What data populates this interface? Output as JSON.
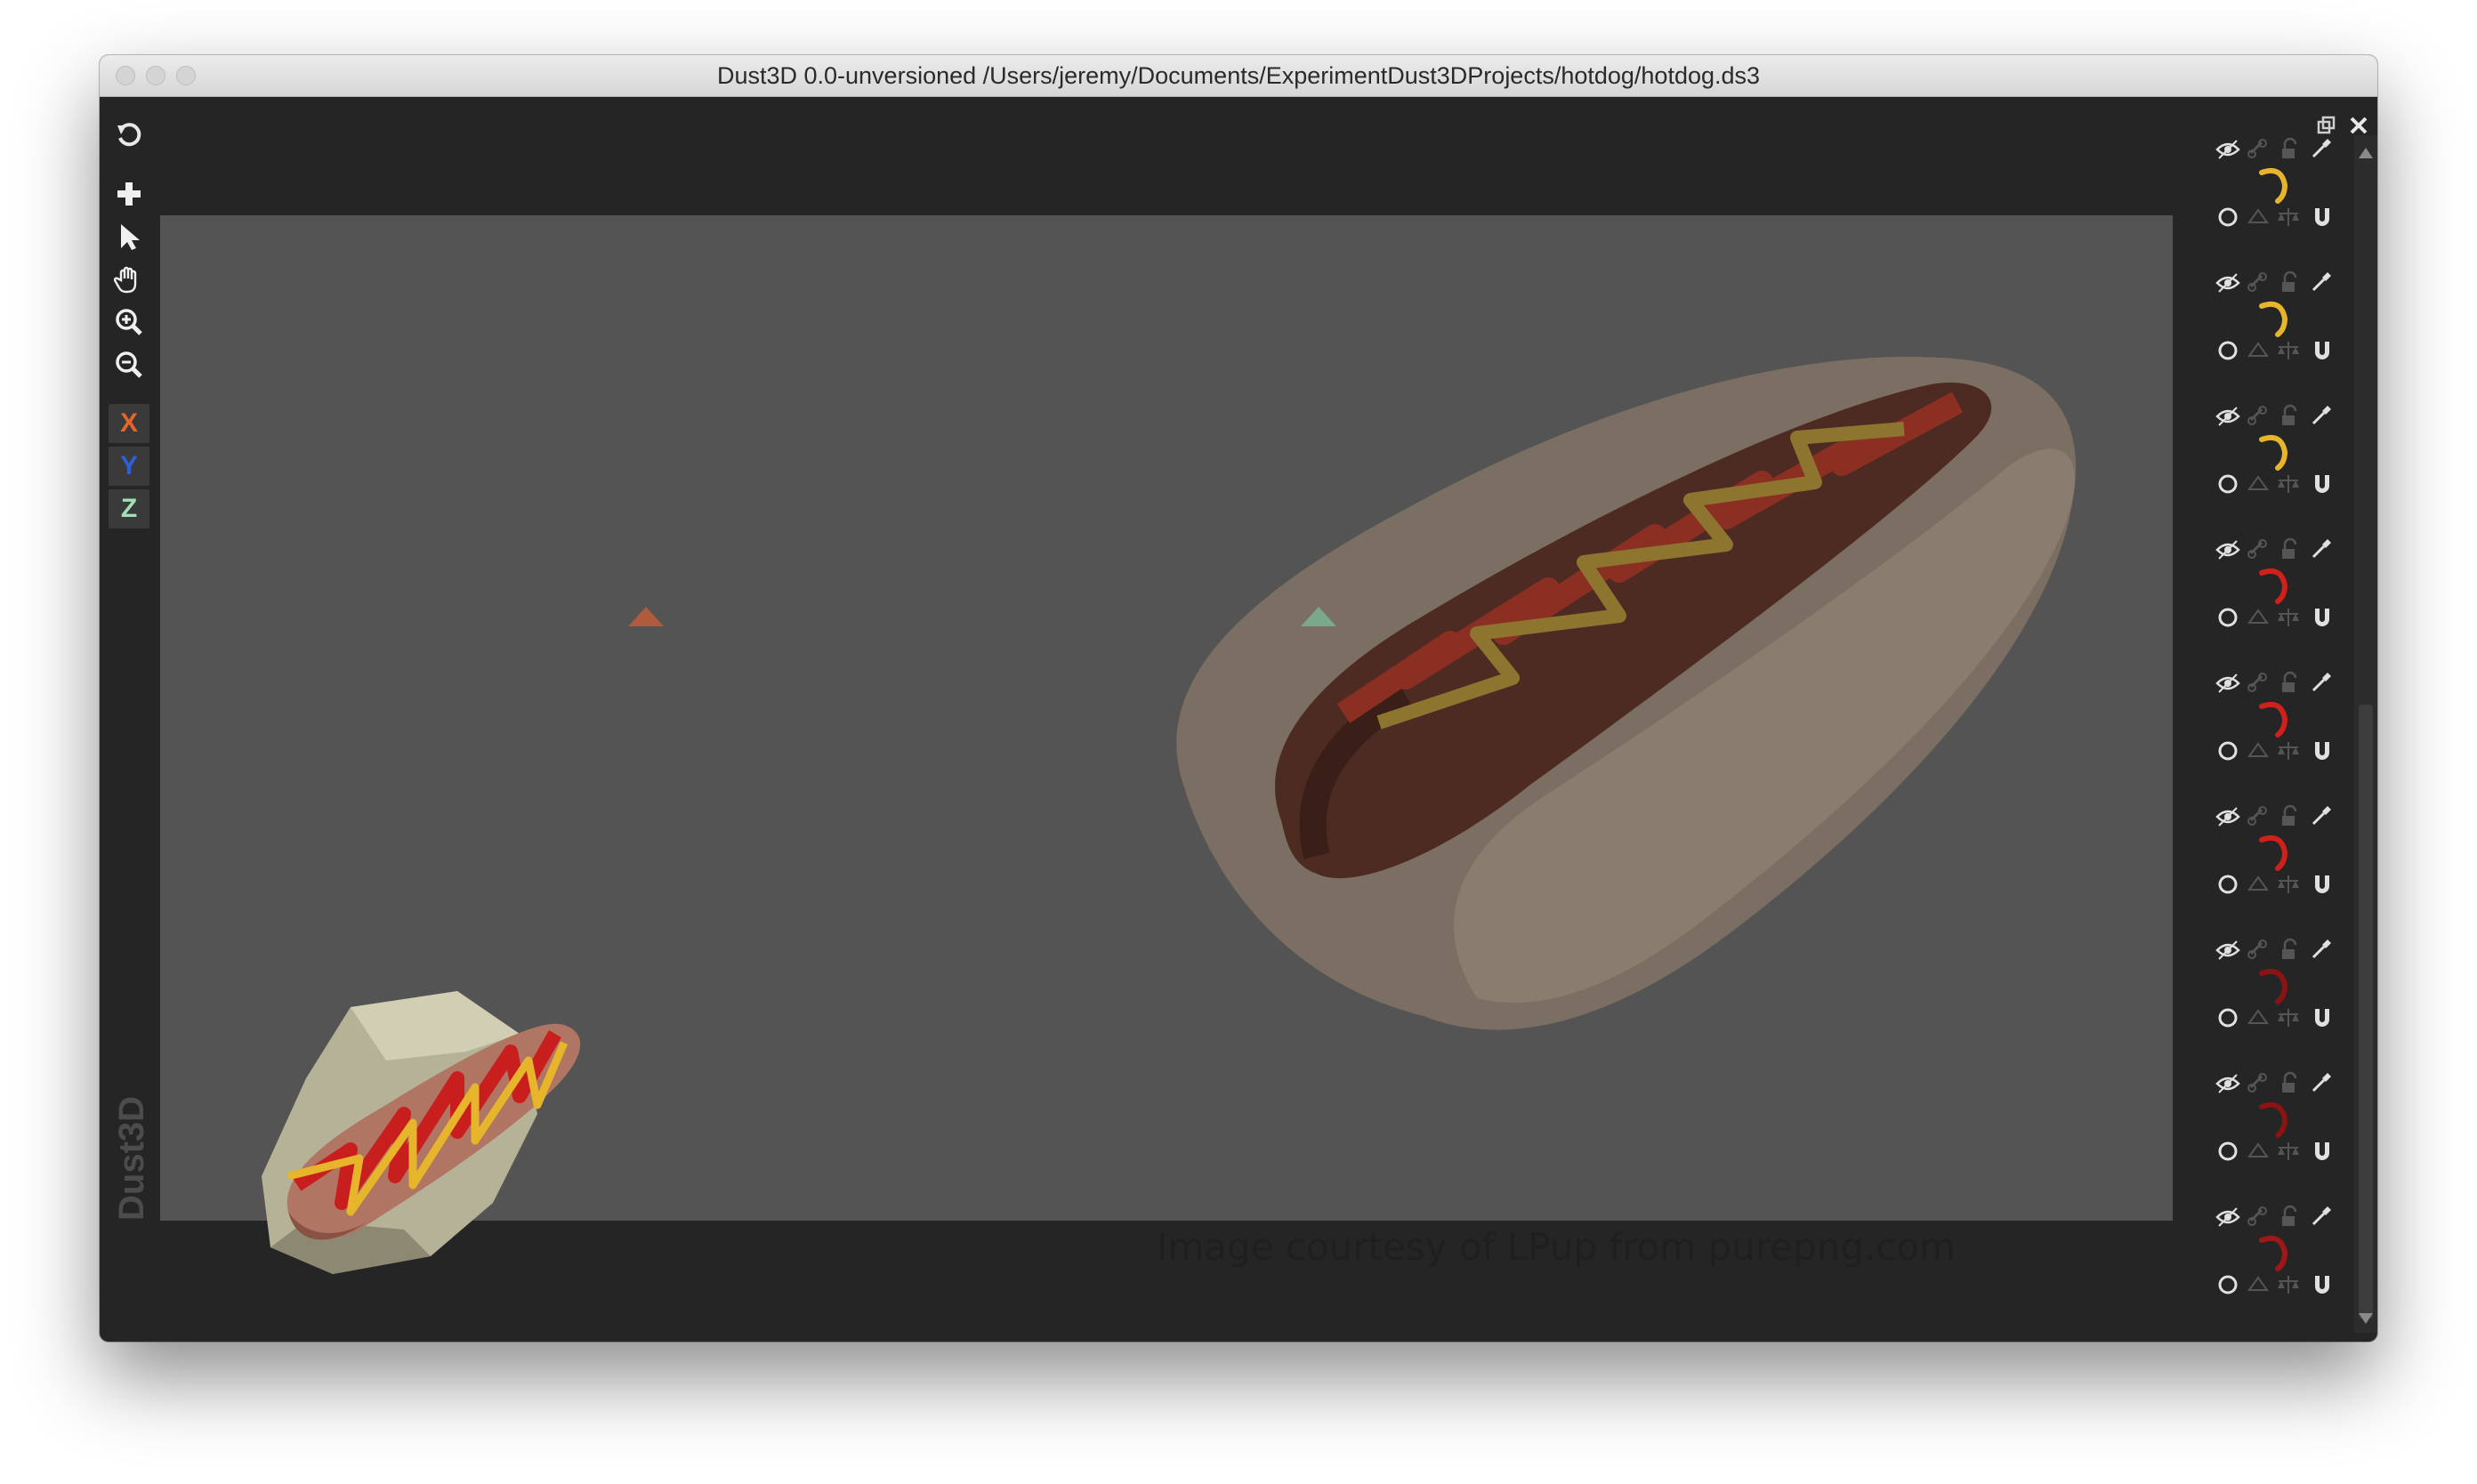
{
  "window": {
    "title": "Dust3D 0.0-unversioned /Users/jeremy/Documents/ExperimentDust3DProjects/hotdog/hotdog.ds3"
  },
  "toolbar": {
    "axis_x": "X",
    "axis_y": "Y",
    "axis_z": "Z",
    "icons": [
      "undo-icon",
      "add-icon",
      "select-icon",
      "hand-icon",
      "zoom-in-icon",
      "zoom-out-icon"
    ]
  },
  "branding": {
    "text": "Dust3D"
  },
  "canvas": {
    "courtesy": "Image courtesy of LPup from purepng.com"
  },
  "colors": {
    "axis_x": "#e8642f",
    "axis_y": "#2d5fd8",
    "axis_z": "#9fe0b8",
    "mustard": "#e6b52b",
    "ketchup_red": "#c81e1e",
    "dark_red": "#8a1313"
  },
  "parts": [
    {
      "color": "#e6b52b"
    },
    {
      "color": "#e6b52b"
    },
    {
      "color": "#e6b52b"
    },
    {
      "color": "#d0201c"
    },
    {
      "color": "#d0201c"
    },
    {
      "color": "#d0201c"
    },
    {
      "color": "#8a1313"
    },
    {
      "color": "#8a1313"
    },
    {
      "color": "#a01717"
    }
  ]
}
